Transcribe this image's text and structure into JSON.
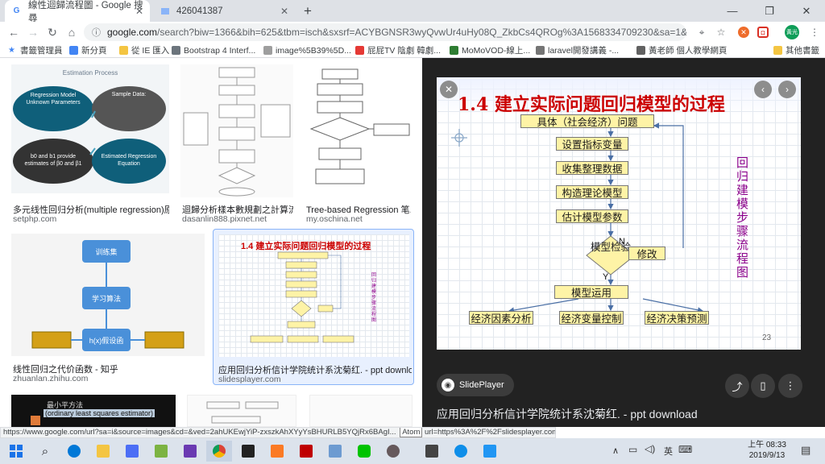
{
  "tabs": [
    {
      "title": "線性迴歸流程圖 - Google 搜尋",
      "favicon": "google-icon"
    },
    {
      "title": "426041387",
      "favicon": "image-icon"
    }
  ],
  "omnibox": {
    "host": "google.com",
    "rest": "/search?biw=1366&bih=625&tbm=isch&sxsrf=ACYBGNSR3wyQvwUr4uHy08Q_ZkbCs4QROg%3A1568334709230&sa=1&ei=deN6..."
  },
  "bookmarks": [
    "書籤管理員",
    "新分頁",
    "從 IE 匯入",
    "Bootstrap 4 Interf...",
    "image%5B39%5D...",
    "屁屁TV 陰劇 韓劇...",
    "MoMoVOD-線上...",
    "laravel開發講義 -...",
    "黃老師 個人教學網頁",
    "其他書籤"
  ],
  "profile": "黃光",
  "results": [
    {
      "title": "多元线性回归分析(multiple regression)原理...",
      "source": "setphp.com"
    },
    {
      "title": "迴歸分析樣本數規劃之計算流...",
      "source": "dasanlin888.pixnet.net"
    },
    {
      "title": "Tree-based Regression 笔...",
      "source": "my.oschina.net"
    },
    {
      "title": "线性回归之代价函数 - 知乎",
      "source": "zhuanlan.zhihu.com"
    },
    {
      "title": "应用回归分析信计学院统计系沈菊红. - ppt download",
      "source": "slidesplayer.com"
    }
  ],
  "thumb_texts": {
    "estimation_title": "Estimation Process",
    "regression_model": "Regression Model",
    "sample_data": "Sample Data:",
    "unknown_params": "Unknown Parameters",
    "estimates": "b0 and b1 provide estimates of β0 and β1",
    "estimated_eq": "Estimated Regression Equation",
    "training_set": "训练集",
    "learning_alg": "学习算法",
    "hypothesis": "h(x)假设函",
    "ols": "最小平方法",
    "ols_en": "(ordinary least squares estimator)"
  },
  "preview": {
    "slide_title": "1.4 建立实际问题回归模型的过程",
    "boxes": [
      "具体（社会经济）问题",
      "设置指标变量",
      "收集整理数据",
      "构造理论模型",
      "估计模型参数",
      "模型检验",
      "修改",
      "模型运用",
      "经济因素分析",
      "经济变量控制",
      "经济决策预测"
    ],
    "label_n": "N",
    "label_y": "Y",
    "side_text": "回归建模步骤流程图",
    "page_number": "23",
    "site": "SlidePlayer",
    "caption": "应用回归分析信计学院统计系沈菊红. - ppt download"
  },
  "statusbar": "https://www.google.com/url?sa=i&source=images&cd=&ved=2ahUKEwjYiP-zxszkAhXYyYsBHURLB5YQjRx6BAgI...",
  "atom_label": "Atom",
  "statusbar_right": "url=https%3A%2F%2Fslidesplayer.com%2Fslide%2F11334782%2F&psig=AOvVaw0QpIzEGofdzxjbOiaRsGlK&ust=1...",
  "taskbar": {
    "ime": "英",
    "time": "上午 08:33",
    "date": "2019/9/13"
  }
}
